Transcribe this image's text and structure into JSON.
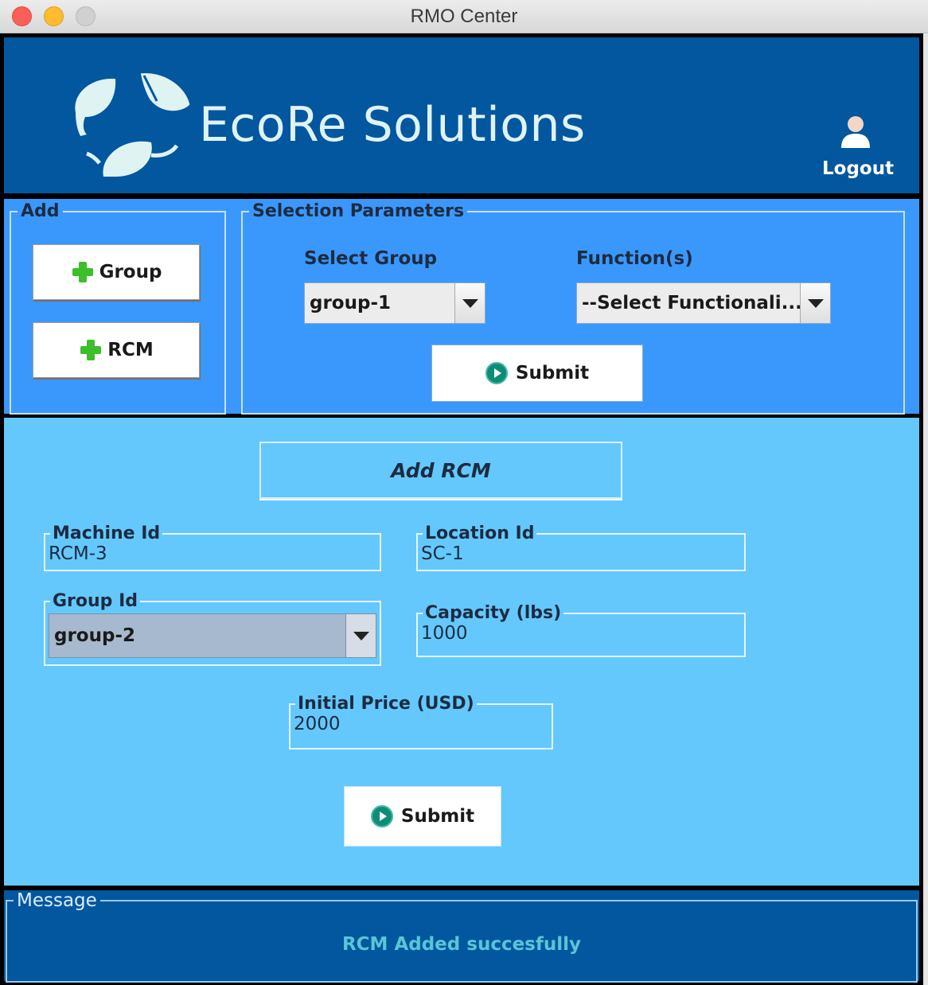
{
  "window": {
    "title": "RMO Center"
  },
  "header": {
    "brand": "EcoRe Solutions",
    "logout_label": "Logout",
    "brand_color": "#02579f"
  },
  "add_panel": {
    "legend": "Add",
    "group_button": "Group",
    "rcm_button": "RCM"
  },
  "selection": {
    "legend": "Selection Parameters",
    "group_label": "Select Group",
    "group_value": "group-1",
    "function_label": "Function(s)",
    "function_value": "--Select Functionali...",
    "submit_label": "Submit"
  },
  "form": {
    "title": "Add RCM",
    "machine_id_label": "Machine Id",
    "machine_id_value": "RCM-3",
    "location_id_label": "Location Id",
    "location_id_value": "SC-1",
    "group_id_label": "Group Id",
    "group_id_value": "group-2",
    "capacity_label": "Capacity (lbs)",
    "capacity_value": "1000",
    "price_label": "Initial Price (USD)",
    "price_value": "2000",
    "submit_label": "Submit"
  },
  "message": {
    "legend": "Message",
    "text": "RCM  Added succesfully"
  },
  "colors": {
    "toolbar_bg": "#3a98fd",
    "form_bg": "#64c8fd",
    "message_text": "#5bc4d6"
  }
}
